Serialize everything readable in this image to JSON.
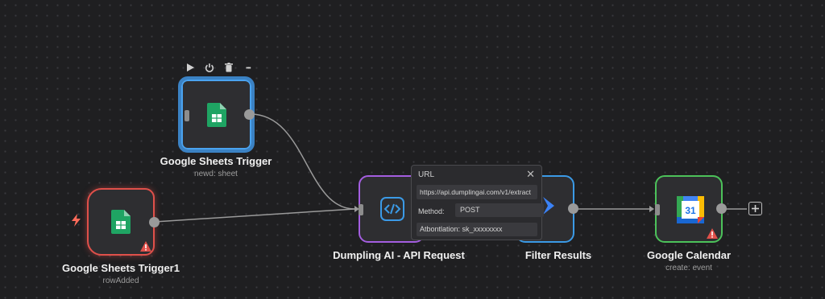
{
  "nodes": {
    "sheets_trigger": {
      "label": "Google Sheets Trigger",
      "subtitle": "newd: sheet",
      "icon": "google-sheets-icon"
    },
    "sheets_trigger1": {
      "label": "Google Sheets Trigger1",
      "subtitle": "rowAdded",
      "icon": "google-sheets-icon"
    },
    "dumpling": {
      "label": "Dumpling AI - API Request",
      "icon": "code-brackets-icon"
    },
    "filter": {
      "label": "Filter Results",
      "icon": "filter-icon"
    },
    "calendar": {
      "label": "Google Calendar",
      "subtitle": "create: event",
      "icon": "google-calendar-icon",
      "icon_text": "31"
    }
  },
  "popup": {
    "title": "URL",
    "close": "✕",
    "url_value": "https://api.dumplingai.com/v1/extract",
    "method_label": "Method:",
    "method_value": "POST",
    "auth_value": "Atbontlation: sk_xxxxxxxx"
  },
  "toolbar": {
    "icons": [
      "play-icon",
      "power-icon",
      "trash-icon",
      "more-icon"
    ],
    "more_text": "•••"
  },
  "colors": {
    "selected": "#4aa3f0",
    "error": "#e0504a",
    "dumpling_border": "#a45ee0",
    "success": "#4cc25a",
    "canvas": "#1f1f21"
  }
}
